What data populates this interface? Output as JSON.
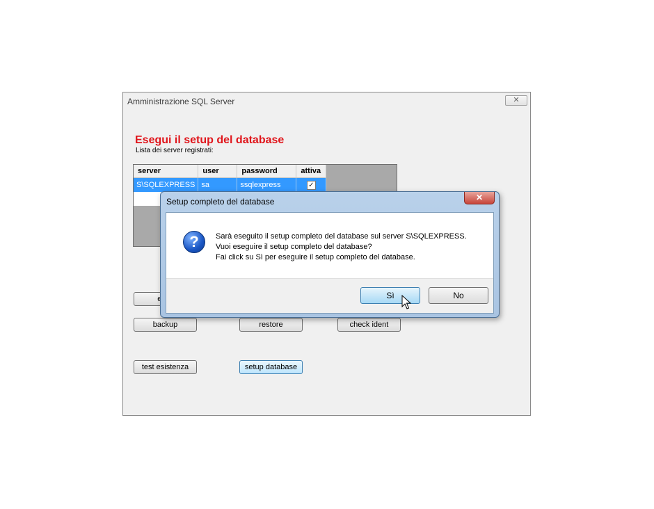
{
  "main_window": {
    "title": "Amministrazione SQL Server",
    "close_glyph": "✕",
    "heading": "Esegui il setup del database",
    "subheading": "Lista dei server registrati:",
    "grid": {
      "columns": [
        "server",
        "user",
        "password",
        "attiva"
      ],
      "rows": [
        {
          "server": "S\\SQLEXPRESS",
          "user": "sa",
          "password": "ssqlexpress",
          "attiva": "✓"
        }
      ]
    },
    "buttons": {
      "elimina": "elimi",
      "backup": "backup",
      "restore": "restore",
      "check_ident": "check ident",
      "test_esistenza": "test esistenza",
      "setup_database": "setup database"
    }
  },
  "dialog": {
    "title": "Setup completo del database",
    "close_glyph": "✕",
    "icon": "question-icon",
    "icon_glyph": "?",
    "message": [
      "Sarà eseguito il setup completo del database sul server S\\SQLEXPRESS.",
      "Vuoi eseguire il setup completo del database?",
      "Fai click su Sì per eseguire il setup completo del database."
    ],
    "yes_label": "Sì",
    "no_label": "No"
  },
  "colors": {
    "heading": "#e0151b",
    "selection": "#3399ff"
  }
}
